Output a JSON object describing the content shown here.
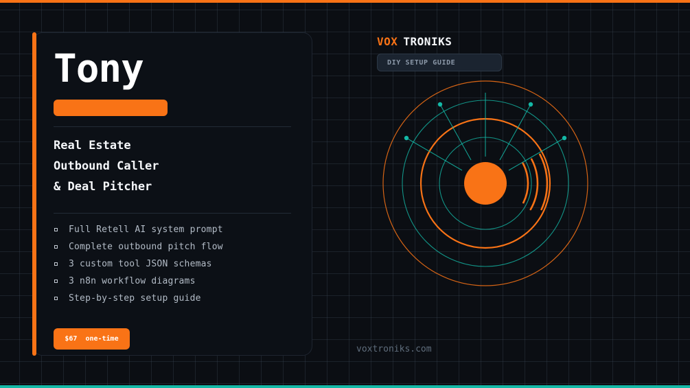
{
  "product": {
    "name": "Tony",
    "subtitle_lines": [
      "Real Estate",
      "Outbound Caller",
      "& Deal Pitcher"
    ],
    "features": [
      "Full Retell AI system prompt",
      "Complete outbound pitch flow",
      "3 custom tool JSON schemas",
      "3 n8n workflow diagrams",
      "Step-by-step setup guide"
    ],
    "price": {
      "amount": "$67",
      "term": "one-time"
    }
  },
  "brand": {
    "part1": "VOX",
    "part2": "TRONIKS",
    "tagline": "DIY SETUP GUIDE",
    "website": "voxtroniks.com"
  },
  "colors": {
    "accent": "#f97316",
    "teal": "#14b8a6",
    "background": "#0b0e13",
    "card": "#0c1016"
  },
  "icons": {
    "feature_bullet": "square-bullet-icon",
    "hero_graphic": "voice-radar-icon"
  }
}
